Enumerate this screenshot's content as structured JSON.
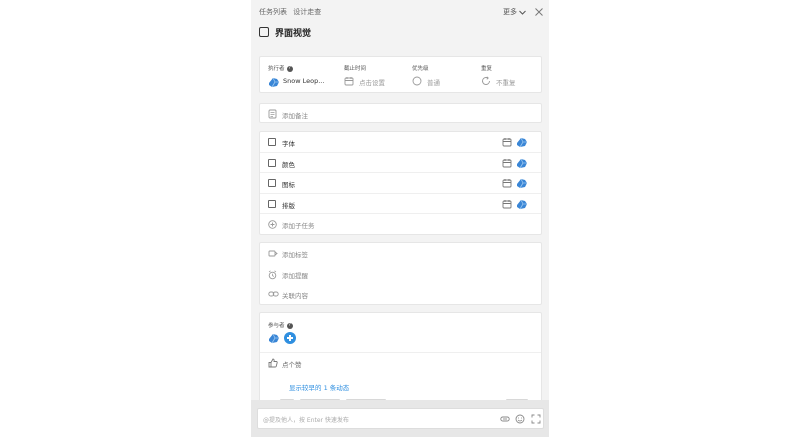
{
  "header": {
    "breadcrumb_parent": "任务列表",
    "breadcrumb_current": "设计走查",
    "more_label": "更多"
  },
  "task": {
    "title": "界面视觉",
    "completed": false
  },
  "meta": {
    "assignee": {
      "label": "执行者",
      "value": "Snow Leop..."
    },
    "deadline": {
      "label": "截止时间",
      "value": "点击设置"
    },
    "priority": {
      "label": "优先级",
      "value": "普通"
    },
    "repeat": {
      "label": "重复",
      "value": "不重复"
    }
  },
  "note": {
    "placeholder": "添加备注"
  },
  "subtasks": {
    "items": [
      {
        "label": "字体",
        "done": false
      },
      {
        "label": "颜色",
        "done": false
      },
      {
        "label": "图标",
        "done": false
      },
      {
        "label": "排版",
        "done": false
      }
    ],
    "add_label": "添加子任务"
  },
  "extras": {
    "tag_label": "添加标签",
    "reminder_label": "添加提醒",
    "link_label": "关联内容"
  },
  "participants": {
    "label": "参与者"
  },
  "like_label": "点个赞",
  "activity_link": "显示较早的 1 条动态",
  "composer": {
    "placeholder": "@提及他人，按 Enter 快速发布"
  },
  "colors": {
    "accent": "#2f8fe0",
    "panel_bg": "#f3f3f3",
    "card_bg": "#ffffff"
  },
  "icons": [
    "chevron-down-icon",
    "close-icon",
    "calendar-icon",
    "priority-circle-icon",
    "repeat-icon",
    "note-icon",
    "add-circle-icon",
    "tag-icon",
    "alarm-icon",
    "link-icon",
    "thumbs-up-icon",
    "attach-icon",
    "emoji-icon",
    "fullscreen-icon"
  ]
}
